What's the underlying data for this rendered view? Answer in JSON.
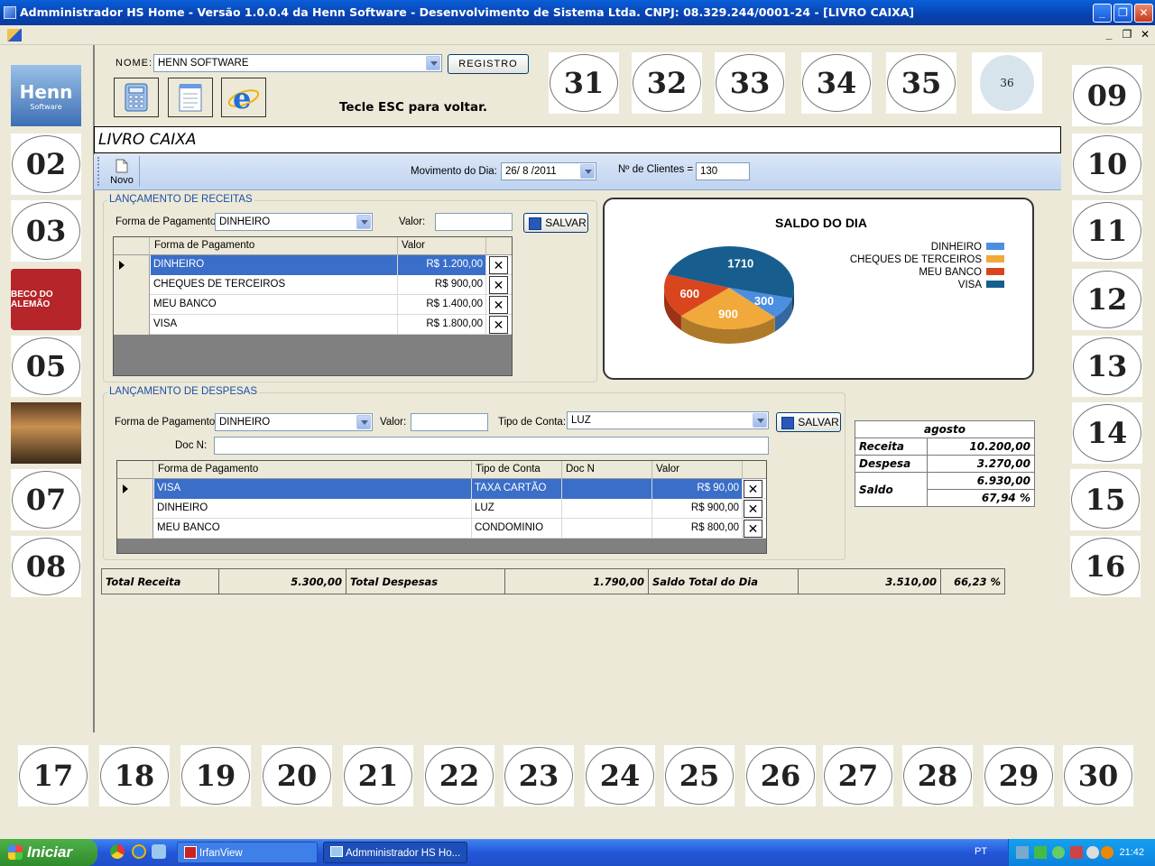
{
  "window": {
    "title": "Admministrador HS Home - Versão 1.0.0.4 da Henn Software - Desenvolvimento de Sistema Ltda. CNPJ: 08.329.244/0001-24 - [LIVRO CAIXA]",
    "minimize": "_",
    "restore": "❐",
    "close": "✕",
    "mdi_minimize": "_",
    "mdi_restore": "❐",
    "mdi_close": "✕"
  },
  "left_tiles": [
    {
      "label": "Henn",
      "sub": "Software",
      "kind": "logo-henn"
    },
    {
      "label": "02"
    },
    {
      "label": "03"
    },
    {
      "label": "BECO DO ALEMÃO",
      "kind": "logo-beco"
    },
    {
      "label": "05"
    },
    {
      "label": "",
      "kind": "logo-mall"
    },
    {
      "label": "07"
    },
    {
      "label": "08"
    }
  ],
  "right_tiles": [
    "09",
    "10",
    "11",
    "12",
    "13",
    "14",
    "15",
    "16"
  ],
  "top_tiles": [
    "31",
    "32",
    "33",
    "34",
    "35",
    "36"
  ],
  "bottom_tiles": [
    "17",
    "18",
    "19",
    "20",
    "21",
    "22",
    "23",
    "24",
    "25",
    "26",
    "27",
    "28",
    "29",
    "30"
  ],
  "header": {
    "nome_label": "NOME:",
    "nome_value": "HENN SOFTWARE",
    "registro_button": "REGISTRO",
    "esc_hint": "Tecle ESC para voltar."
  },
  "form_title": "LIVRO CAIXA",
  "toolbar": {
    "novo_label": "Novo",
    "movimento_label": "Movimento do Dia:",
    "movimento_value": "26/ 8 /2011",
    "clientes_label": "Nº de Clientes  =",
    "clientes_value": "130"
  },
  "receitas": {
    "group_title": "LANÇAMENTO DE RECEITAS",
    "forma_label": "Forma de Pagamento:",
    "forma_value": "DINHEIRO",
    "valor_label": "Valor:",
    "valor_value": "",
    "save_button": "SALVAR",
    "columns": [
      "Forma de Pagamento",
      "Valor"
    ],
    "rows": [
      {
        "forma": "DINHEIRO",
        "valor": "R$ 1.200,00",
        "selected": true
      },
      {
        "forma": "CHEQUES DE TERCEIROS",
        "valor": "R$ 900,00"
      },
      {
        "forma": "MEU BANCO",
        "valor": "R$ 1.400,00"
      },
      {
        "forma": "VISA",
        "valor": "R$ 1.800,00"
      }
    ]
  },
  "despesas": {
    "group_title": "LANÇAMENTO DE DESPESAS",
    "forma_label": "Forma de Pagamento:",
    "forma_value": "DINHEIRO",
    "valor_label": "Valor:",
    "valor_value": "",
    "tipo_label": "Tipo de Conta:",
    "tipo_value": "LUZ",
    "doc_label": "Doc N:",
    "doc_value": "",
    "save_button": "SALVAR",
    "columns": [
      "Forma de Pagamento",
      "Tipo de Conta",
      "Doc N",
      "Valor"
    ],
    "rows": [
      {
        "forma": "VISA",
        "tipo": "TAXA CARTÃO",
        "doc": "",
        "valor": "R$ 90,00",
        "selected": true
      },
      {
        "forma": "DINHEIRO",
        "tipo": "LUZ",
        "doc": "",
        "valor": "R$ 900,00"
      },
      {
        "forma": "MEU BANCO",
        "tipo": "CONDOMINIO",
        "doc": "",
        "valor": "R$ 800,00"
      }
    ]
  },
  "chart_data": {
    "type": "pie",
    "title": "SALDO DO DIA",
    "categories": [
      "DINHEIRO",
      "CHEQUES DE TERCEIROS",
      "MEU BANCO",
      "VISA"
    ],
    "values": [
      300,
      900,
      600,
      1710
    ],
    "colors": [
      "#4a8fe0",
      "#f2a93b",
      "#d9461e",
      "#175e8e"
    ],
    "legend": "top-right"
  },
  "monthly": {
    "month": "agosto",
    "receita_label": "Receita",
    "receita_value": "10.200,00",
    "despesa_label": "Despesa",
    "despesa_value": "3.270,00",
    "saldo_label": "Saldo",
    "saldo_value": "6.930,00",
    "saldo_pct": "67,94 %"
  },
  "totals": {
    "receita_label": "Total Receita",
    "receita_value": "5.300,00",
    "despesas_label": "Total Despesas",
    "despesas_value": "1.790,00",
    "saldo_label": "Saldo Total do Dia",
    "saldo_value": "3.510,00",
    "saldo_pct": "66,23 %"
  },
  "taskbar": {
    "start": "Iniciar",
    "tasks": [
      "IrfanView",
      "Admministrador HS Ho..."
    ],
    "lang": "PT",
    "clock": "21:42"
  }
}
